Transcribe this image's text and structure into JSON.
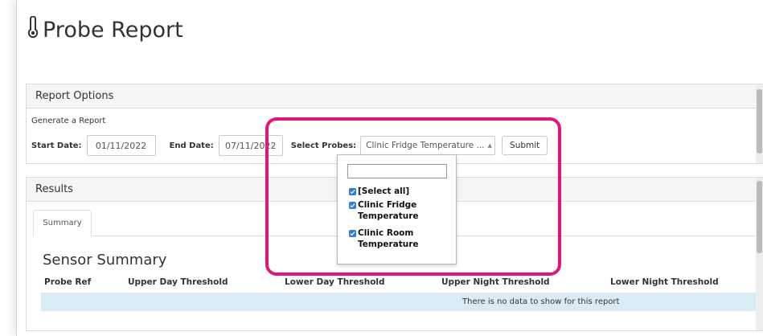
{
  "page": {
    "title": "Probe Report",
    "icon": "thermometer-icon"
  },
  "options": {
    "header": "Report Options",
    "generate_label": "Generate a Report",
    "start_date_label": "Start Date:",
    "start_date_value": "01/11/2022",
    "end_date_label": "End Date:",
    "end_date_value": "07/11/2022",
    "select_probes_label": "Select Probes:",
    "select_probes_value": "Clinic Fridge Temperature ...",
    "submit_label": "Submit"
  },
  "dropdown": {
    "items": [
      {
        "label": "[Select all]",
        "checked": true
      },
      {
        "label": "Clinic Fridge Temperature",
        "checked": true
      },
      {
        "label": "Clinic Room Temperature",
        "checked": true
      }
    ]
  },
  "results": {
    "header": "Results",
    "tabs": [
      {
        "label": "Summary",
        "active": true
      }
    ],
    "summary_title": "Sensor Summary",
    "columns": [
      "Probe Ref",
      "Upper Day Threshold",
      "Lower Day Threshold",
      "Upper Night Threshold",
      "Lower Night Threshold"
    ],
    "no_data_message": "There is no data to show for this report"
  },
  "colors": {
    "highlight": "#e3157a",
    "checkbox": "#2f7fd9",
    "no_data_row": "#d9ecf5"
  }
}
